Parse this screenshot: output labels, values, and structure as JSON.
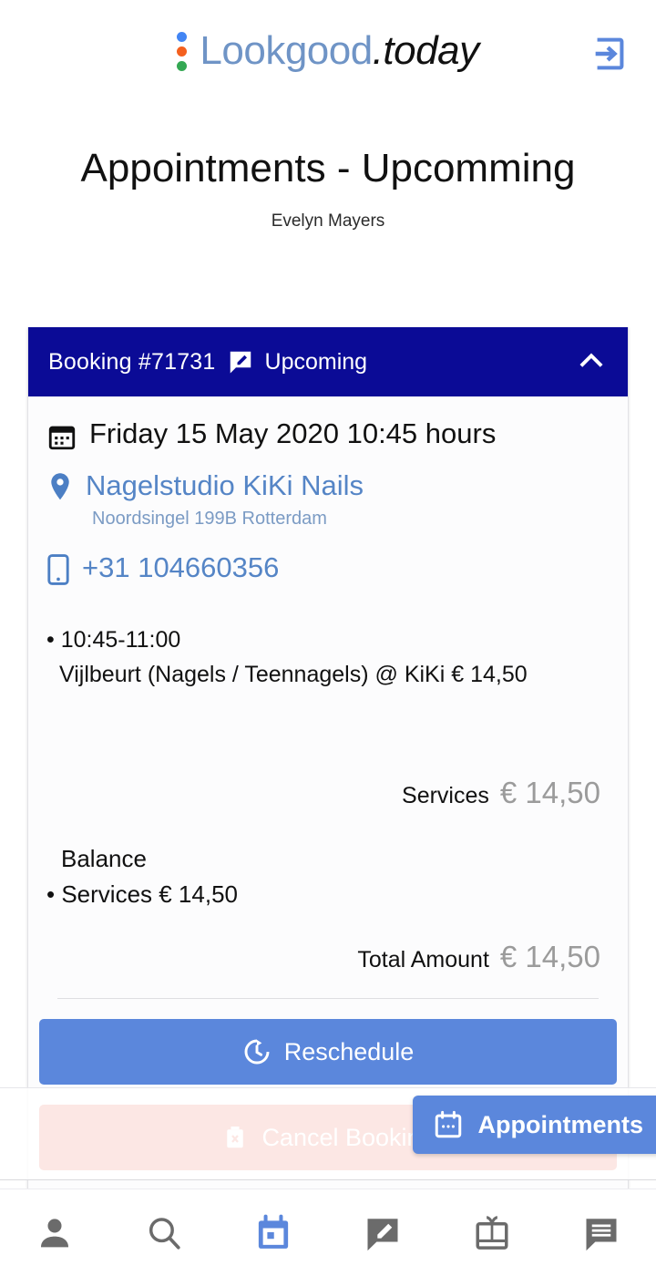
{
  "brand": {
    "name": "Lookgood",
    "suffix": ".today",
    "dot_colors": [
      "#4285F4",
      "#F4601E",
      "#34A853"
    ],
    "login_icon": "login-icon"
  },
  "page": {
    "title": "Appointments - Upcomming",
    "subtitle": "Evelyn Mayers"
  },
  "booking_card": {
    "header": {
      "booking_label": "Booking #71731",
      "status": "Upcoming",
      "status_icon": "review-bubble-icon",
      "collapse_icon": "chevron-up-icon",
      "background": "#0B0B96"
    },
    "date": "Friday 15 May 2020 10:45 hours",
    "venue": {
      "name": "Nagelstudio KiKi Nails",
      "address": "Noordsingel 199B Rotterdam"
    },
    "phone": "+31 104660356",
    "services": [
      {
        "time": "• 10:45-11:00",
        "description": "Vijlbeurt (Nagels / Teennagels) @ KiKi € 14,50"
      }
    ],
    "services_total": {
      "label": "Services",
      "value": "€ 14,50"
    },
    "balance": {
      "title": "Balance",
      "items": [
        "• Services € 14,50"
      ]
    },
    "total": {
      "label": "Total Amount",
      "value": "€ 14,50"
    },
    "actions": {
      "reschedule": {
        "label": "Reschedule",
        "icon": "update-clock-icon",
        "color": "#5B87DC"
      },
      "cancel": {
        "label": "Cancel Booking",
        "icon": "delete-trash-icon",
        "color": "#E8573F"
      }
    }
  },
  "floating_button": {
    "label": "Appointments",
    "icon": "calendar-icon",
    "color": "#5B87DC"
  },
  "bottom_nav": [
    {
      "name": "profile",
      "icon": "person-icon",
      "active": false
    },
    {
      "name": "search",
      "icon": "search-icon",
      "active": false
    },
    {
      "name": "appointments",
      "icon": "calendar-icon",
      "active": true
    },
    {
      "name": "reviews",
      "icon": "review-bubble-icon",
      "active": false
    },
    {
      "name": "giftcards",
      "icon": "giftcard-icon",
      "active": false
    },
    {
      "name": "messages",
      "icon": "chat-icon",
      "active": false
    }
  ],
  "colors": {
    "accent_blue": "#5B87DC",
    "link_blue": "#5585C6",
    "header_navy": "#0B0B96",
    "muted_gray": "#9b9b9b",
    "nav_inactive": "#6b6b6b"
  }
}
